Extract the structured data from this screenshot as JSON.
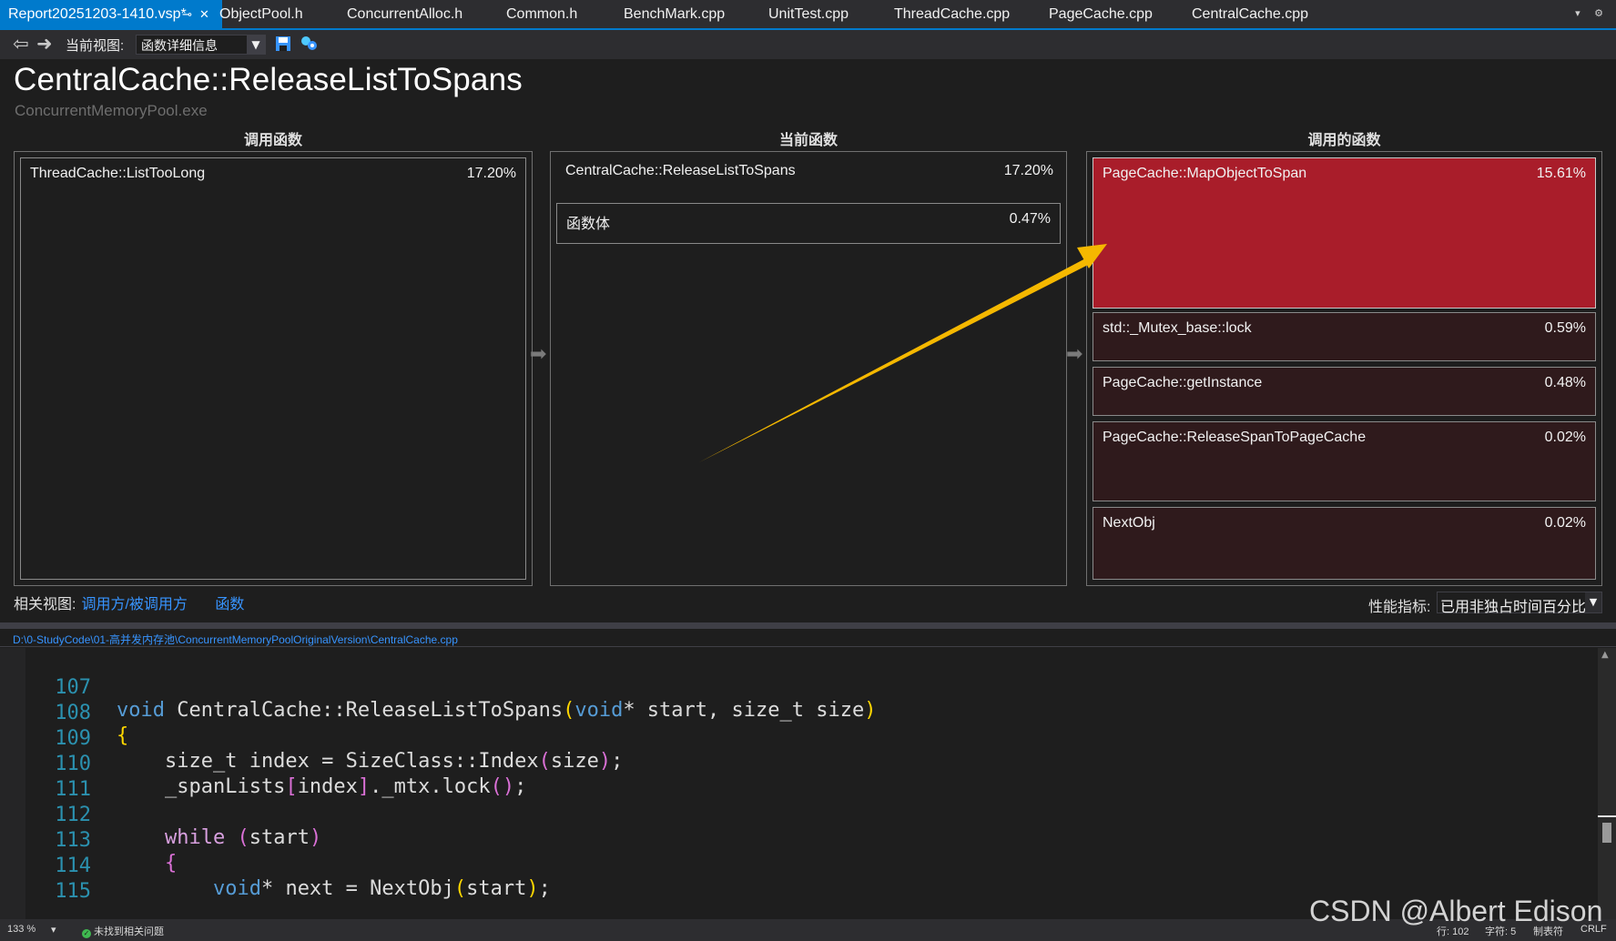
{
  "tabs": [
    {
      "label": "Report20251203-1410.vsp*",
      "active": true,
      "pin_icon": "pin-icon",
      "close_icon": "close-icon"
    },
    {
      "label": "ObjectPool.h"
    },
    {
      "label": "ConcurrentAlloc.h"
    },
    {
      "label": "Common.h"
    },
    {
      "label": "BenchMark.cpp"
    },
    {
      "label": "UnitTest.cpp"
    },
    {
      "label": "ThreadCache.cpp"
    },
    {
      "label": "PageCache.cpp"
    },
    {
      "label": "CentralCache.cpp"
    }
  ],
  "toolbar": {
    "back_icon": "back-arrow-icon",
    "forward_icon": "forward-arrow-icon",
    "view_label": "当前视图:",
    "view_value": "函数详细信息",
    "save_icon": "save-icon",
    "compare_icon": "settings-icon"
  },
  "header": {
    "title": "CentralCache::ReleaseListToSpans",
    "process": "ConcurrentMemoryPool.exe"
  },
  "columns": {
    "callers_title": "调用函数",
    "current_title": "当前函数",
    "callees_title": "调用的函数"
  },
  "callers": [
    {
      "name": "ThreadCache::ListTooLong",
      "percent": "17.20%"
    }
  ],
  "current": {
    "name": "CentralCache::ReleaseListToSpans",
    "percent": "17.20%",
    "body_name": "函数体",
    "body_percent": "0.47%"
  },
  "callees": [
    {
      "name": "PageCache::MapObjectToSpan",
      "percent": "15.61%"
    },
    {
      "name": "std::_Mutex_base::lock",
      "percent": "0.59%"
    },
    {
      "name": "PageCache::getInstance",
      "percent": "0.48%"
    },
    {
      "name": "PageCache::ReleaseSpanToPageCache",
      "percent": "0.02%"
    },
    {
      "name": "NextObj",
      "percent": "0.02%"
    }
  ],
  "related": {
    "label": "相关视图:",
    "links": [
      "调用方/被调用方",
      "函数"
    ]
  },
  "metric": {
    "label": "性能指标:",
    "value": "已用非独占时间百分比"
  },
  "file_path": "D:\\0-StudyCode\\01-高并发内存池\\ConcurrentMemoryPoolOriginalVersion\\CentralCache.cpp",
  "code": {
    "lines": [
      {
        "no": "107"
      },
      {
        "no": "108"
      },
      {
        "no": "109"
      },
      {
        "no": "110"
      },
      {
        "no": "111"
      },
      {
        "no": "112"
      },
      {
        "no": "113"
      },
      {
        "no": "114"
      },
      {
        "no": "115"
      }
    ],
    "tokens": {
      "l107_void": "void",
      "l107_sig": " CentralCache::ReleaseListToSpans",
      "l107_open": "(",
      "l107_void2": "void",
      "l107_args": "* start, size_t size",
      "l107_close": ")",
      "l108": "{",
      "l109_a": "    size_t index = SizeClass::Index",
      "l109_open": "(",
      "l109_arg": "size",
      "l109_close": ")",
      "l109_end": ";",
      "l110_a": "    _spanLists",
      "l110_ob": "[",
      "l110_idx": "index",
      "l110_cb": "]",
      "l110_b": "._mtx.lock",
      "l110_paren": "()",
      "l110_end": ";",
      "l112_while": "    while",
      "l112_sp": " ",
      "l112_open": "(",
      "l112_arg": "start",
      "l112_close": ")",
      "l113": "    {",
      "l114_ind": "        ",
      "l114_void": "void",
      "l114_a": "* next = NextObj",
      "l114_open": "(",
      "l114_arg": "start",
      "l114_close": ")",
      "l114_end": ";"
    }
  },
  "status": {
    "zoom": "133 %",
    "issues": "未找到相关问题",
    "line": "行: 102",
    "char": "字符: 5",
    "tab": "制表符",
    "eol": "CRLF"
  },
  "watermark": "CSDN @Albert Edison",
  "colors": {
    "accent": "#007acc",
    "hot_node": "#a91d2a",
    "callee_node": "#2f1a1c",
    "annotation_arrow": "#f5b800"
  }
}
